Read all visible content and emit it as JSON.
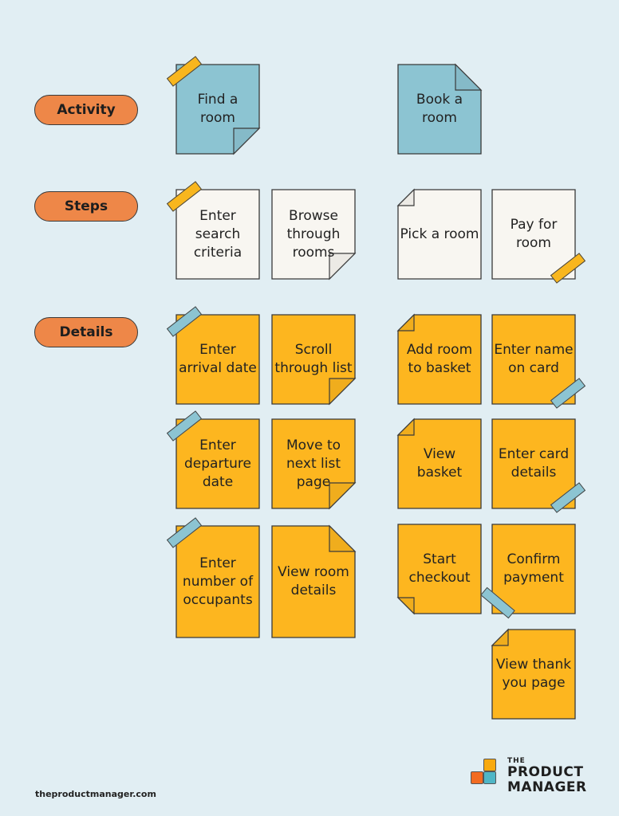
{
  "rows": {
    "activity": "Activity",
    "steps": "Steps",
    "details": "Details"
  },
  "colors": {
    "background": "#e1eef3",
    "activity_note": "#8cc4d2",
    "step_note": "#f8f6f1",
    "detail_note": "#fdb61f",
    "row_label": "#ee8748",
    "tape_yellow": "#f8b61e",
    "tape_blue": "#8cc4d2"
  },
  "activities": [
    {
      "label": "Find a room"
    },
    {
      "label": "Book a room"
    }
  ],
  "steps": [
    {
      "label": "Enter search criteria"
    },
    {
      "label": "Browse through rooms"
    },
    {
      "label": "Pick a room"
    },
    {
      "label": "Pay for room"
    }
  ],
  "details": {
    "col1": [
      {
        "label": "Enter arrival date"
      },
      {
        "label": "Enter departure date"
      },
      {
        "label": "Enter number of occupants"
      }
    ],
    "col2": [
      {
        "label": "Scroll through list"
      },
      {
        "label": "Move to next list page"
      },
      {
        "label": "View room details"
      }
    ],
    "col3": [
      {
        "label": "Add room to basket"
      },
      {
        "label": "View basket"
      },
      {
        "label": "Start checkout"
      }
    ],
    "col4": [
      {
        "label": "Enter name on card"
      },
      {
        "label": "Enter card details"
      },
      {
        "label": "Confirm payment"
      },
      {
        "label": "View thank you page"
      }
    ]
  },
  "footer": {
    "url": "theproductmanager.com",
    "logo_the": "THE",
    "logo_line1": "PRODUCT",
    "logo_line2": "MANAGER"
  }
}
